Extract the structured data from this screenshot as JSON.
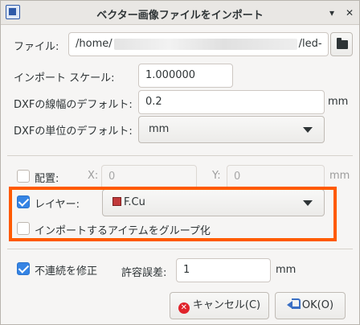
{
  "window": {
    "title": "ベクター画像ファイルをインポート",
    "menu_glyph": "▾",
    "close_glyph": "✕"
  },
  "file": {
    "label": "ファイル:",
    "path_start": "/home/",
    "path_end": "/led-"
  },
  "scale": {
    "label": "インポート スケール:",
    "value": "1.000000"
  },
  "dxf_line_width": {
    "label": "DXFの線幅のデフォルト:",
    "value": "0.2",
    "unit": "mm"
  },
  "dxf_units": {
    "label": "DXFの単位のデフォルト:",
    "selected": "mm"
  },
  "placement": {
    "label": "配置:",
    "checked": false,
    "x_label": "X:",
    "x_value": "0",
    "y_label": "Y:",
    "y_value": "0",
    "unit": "mm"
  },
  "layer": {
    "label": "レイヤー:",
    "checked": true,
    "selected": "F.Cu",
    "swatch_color": "#c1393a"
  },
  "group": {
    "label": "インポートするアイテムをグループ化",
    "checked": false
  },
  "fix_discontinuity": {
    "label": "不連続を修正",
    "checked": true,
    "tolerance_label": "許容誤差:",
    "tolerance_value": "1",
    "unit": "mm"
  },
  "buttons": {
    "cancel": "キャンセル(C)",
    "ok": "OK(O)"
  },
  "colors": {
    "accent": "#3584e4",
    "highlight": "#ff5a00"
  }
}
